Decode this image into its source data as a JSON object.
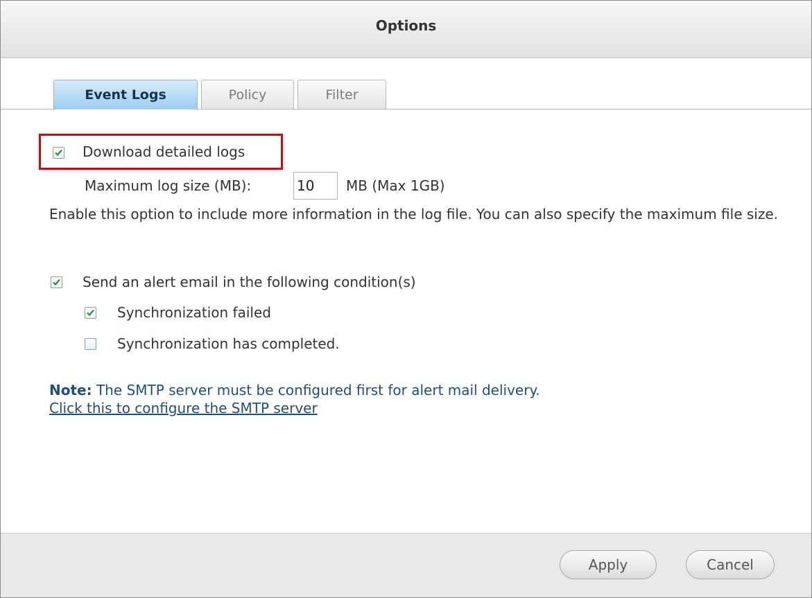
{
  "dialog": {
    "title": "Options"
  },
  "tabs": [
    {
      "label": "Event Logs",
      "active": true
    },
    {
      "label": "Policy",
      "active": false
    },
    {
      "label": "Filter",
      "active": false
    }
  ],
  "event_logs": {
    "download_detailed_logs": {
      "label": "Download detailed logs",
      "checked": true
    },
    "max_log_size": {
      "label": "Maximum log size (MB):",
      "value": "10",
      "unit": "MB (Max 1GB)"
    },
    "description": "Enable this option to include more information in the log file. You can also specify the maximum file size.",
    "send_alert": {
      "label": "Send an alert email in the following condition(s)",
      "checked": true
    },
    "sync_failed": {
      "label": "Synchronization failed",
      "checked": true
    },
    "sync_completed": {
      "label": "Synchronization has completed.",
      "checked": false
    },
    "note_prefix": "Note:",
    "note_text": " The SMTP server must be configured first for alert mail delivery.",
    "smtp_link": "Click this to configure the SMTP server"
  },
  "footer": {
    "apply_label": "Apply",
    "cancel_label": "Cancel"
  },
  "colors": {
    "active_tab": "#9ccdf1",
    "checkmark": "#2e8b3a",
    "highlight_border": "#b4141c",
    "note_text": "#1f4e7a"
  },
  "icons": {
    "checked": "check-icon"
  }
}
